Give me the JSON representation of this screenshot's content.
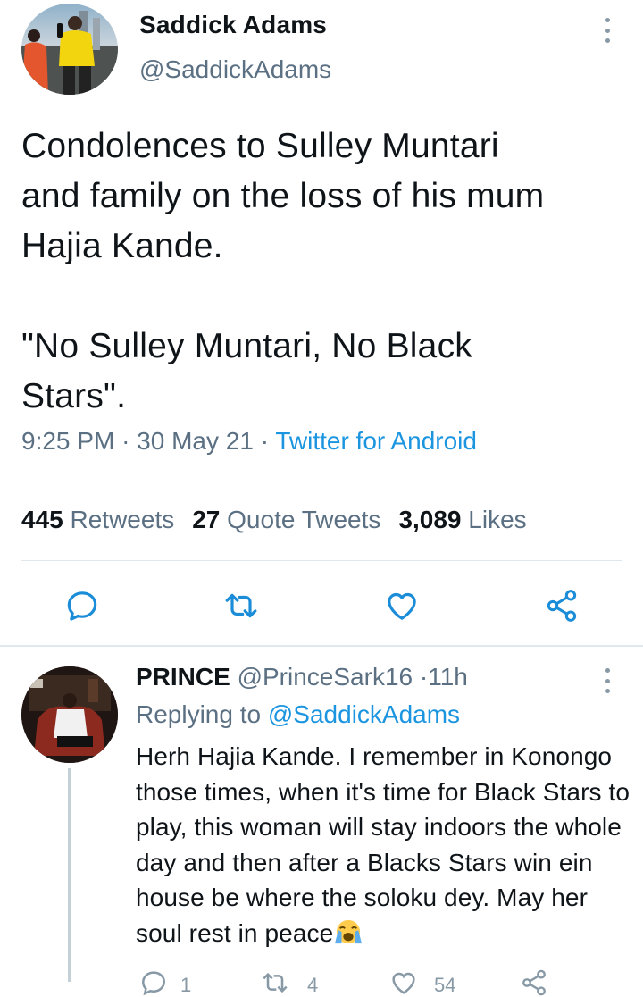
{
  "tweet": {
    "author_name": "Saddick Adams",
    "author_handle": "@SaddickAdams",
    "text": "Condolences to Sulley Muntari\nand family on the loss of his mum\nHajia Kande.\n\n\"No Sulley Muntari, No Black\nStars\".",
    "time": "9:25 PM",
    "date": "30 May 21",
    "client": "Twitter for Android",
    "retweets": "445",
    "retweets_label": "Retweets",
    "quotes": "27",
    "quotes_label": "Quote Tweets",
    "likes": "3,089",
    "likes_label": "Likes"
  },
  "actions": [
    "reply-icon",
    "retweet-icon",
    "like-icon",
    "share-icon"
  ],
  "reply": {
    "author_name": "PRINCE",
    "author_handle": "@PrinceSark16",
    "age": "11h",
    "replying_prefix": "Replying to",
    "replying_to": "@SaddickAdams",
    "text": "Herh Hajia Kande. I remember in Konongo those times, when it's time for Black Stars to play, this woman will stay indoors the whole day and then after a Blacks Stars win ein house be where the soloku dey. May her soul rest in peace",
    "emoji": "loudly-crying-face",
    "counts": [
      "1",
      "4",
      "54"
    ]
  },
  "colors": {
    "accent": "#1b95e0",
    "muted": "#5b7083",
    "divider": "#e1e8ed",
    "icon": "#1a8cd8"
  }
}
